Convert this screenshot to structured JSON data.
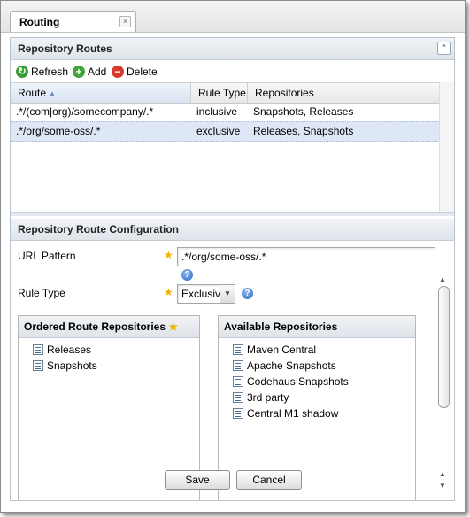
{
  "tab": {
    "label": "Routing",
    "close": "×"
  },
  "routes_section": {
    "title": "Repository Routes"
  },
  "toolbar": {
    "refresh": "Refresh",
    "add": "Add",
    "delete": "Delete"
  },
  "grid": {
    "columns": {
      "route": "Route",
      "rule_type": "Rule Type",
      "repositories": "Repositories"
    },
    "rows": [
      {
        "route": ".*/(com|org)/somecompany/.*",
        "rule_type": "inclusive",
        "repositories": "Snapshots, Releases"
      },
      {
        "route": ".*/org/some-oss/.*",
        "rule_type": "exclusive",
        "repositories": "Releases, Snapshots"
      }
    ]
  },
  "config_section": {
    "title": "Repository Route Configuration"
  },
  "form": {
    "url_pattern_label": "URL Pattern",
    "url_pattern_value": ".*/org/some-oss/.*",
    "rule_type_label": "Rule Type",
    "rule_type_value": "Exclusiv",
    "required_mark": "★",
    "help": "?"
  },
  "ordered": {
    "title": "Ordered Route Repositories",
    "items": [
      "Releases",
      "Snapshots"
    ]
  },
  "available": {
    "title": "Available Repositories",
    "items": [
      "Maven Central",
      "Apache Snapshots",
      "Codehaus Snapshots",
      "3rd party",
      "Central M1 shadow"
    ]
  },
  "buttons": {
    "save": "Save",
    "cancel": "Cancel"
  },
  "colors": {
    "selection": "#dde7f5",
    "header": "#dfe4ea",
    "required": "#f0b400"
  },
  "icons": {
    "refresh": "refresh-icon",
    "add": "add-icon",
    "delete": "delete-icon",
    "sort": "sort-ascending-icon"
  }
}
